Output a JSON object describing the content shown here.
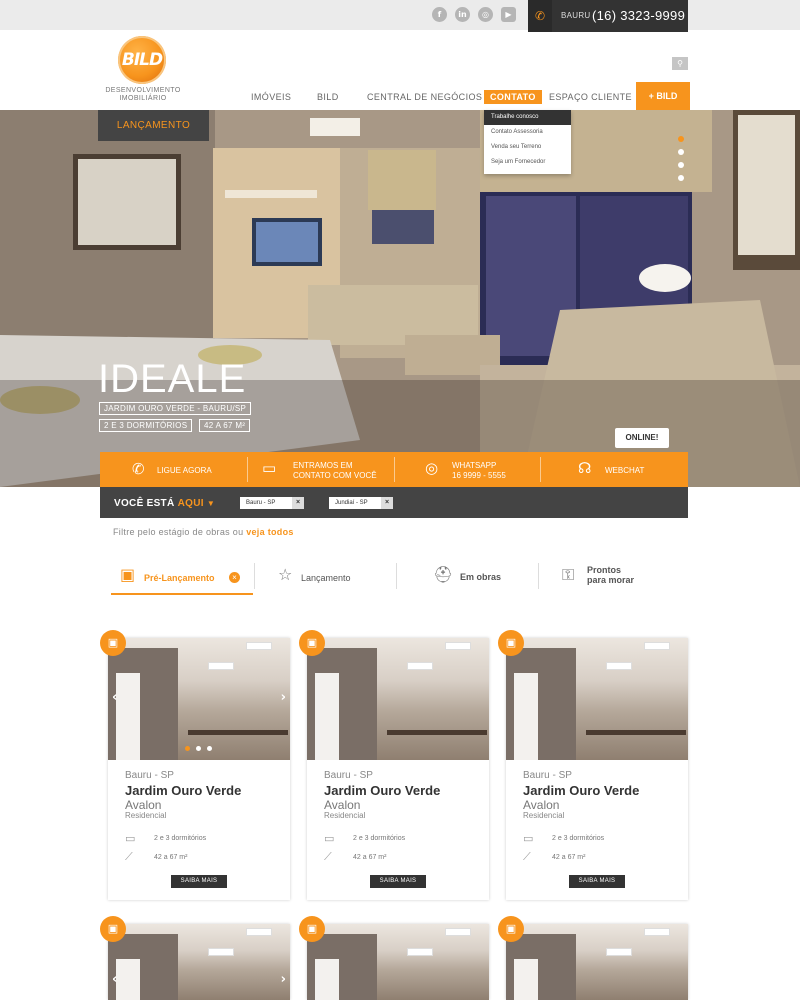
{
  "topbar": {
    "social": [
      "f",
      "in",
      "◎",
      "▶"
    ],
    "phone_city": "BAURU",
    "phone_number": "(16) 3323-9999"
  },
  "logo": {
    "text": "BILD",
    "subtitle": "DESENVOLVIMENTO IMOBILIÁRIO"
  },
  "nav": {
    "items": [
      "IMÓVEIS",
      "BILD",
      "CENTRAL DE NEGÓCIOS",
      "CONTATO",
      "ESPAÇO CLIENTE"
    ],
    "plus_bild": "+ BILD",
    "dropdown": [
      "Trabalhe conosco",
      "Contato Assessoria",
      "Venda seu Terreno",
      "Seja um Fornecedor"
    ]
  },
  "hero": {
    "badge": "LANÇAMENTO",
    "title": "IDEALE",
    "location": "JARDIM OURO VERDE - BAURU/SP",
    "rooms": "2 E 3 DORMITÓRIOS",
    "area": "42 A 67 M²",
    "online": "ONLINE!"
  },
  "contactbar": {
    "ligue": "LIGUE AGORA",
    "entramos1": "ENTRAMOS EM",
    "entramos2": "CONTATO COM VOCÊ",
    "whats1": "WHATSAPP",
    "whats2": "16 9999 - 5555",
    "webchat": "WEBCHAT"
  },
  "location_bar": {
    "label_prefix": "VOCÊ ESTÁ",
    "label_highlight": "AQUI",
    "chips": [
      "Bauru - SP",
      "Jundiaí - SP"
    ]
  },
  "filter": {
    "text": "Filtre pelo estágio de obras ou",
    "link": "veja todos"
  },
  "tabs": {
    "pre": "Pré-Lançamento",
    "lanc": "Lançamento",
    "obras": "Em obras",
    "prontos1": "Prontos",
    "prontos2": "para morar"
  },
  "cards": [
    {
      "city": "Bauru - SP",
      "neighborhood": "Jardim Ouro Verde",
      "name": "Avalon",
      "type": "Residencial",
      "rooms": "2 e 3 dormitórios",
      "area": "42 a 67 m²",
      "button": "SAIBA MAIS"
    },
    {
      "city": "Bauru - SP",
      "neighborhood": "Jardim Ouro Verde",
      "name": "Avalon",
      "type": "Residencial",
      "rooms": "2 e 3 dormitórios",
      "area": "42 a 67 m²",
      "button": "SAIBA MAIS"
    },
    {
      "city": "Bauru - SP",
      "neighborhood": "Jardim Ouro Verde",
      "name": "Avalon",
      "type": "Residencial",
      "rooms": "2 e 3 dormitórios",
      "area": "42 a 67 m²",
      "button": "SAIBA MAIS"
    }
  ],
  "colors": {
    "accent": "#f7941d",
    "dark": "#444444"
  }
}
